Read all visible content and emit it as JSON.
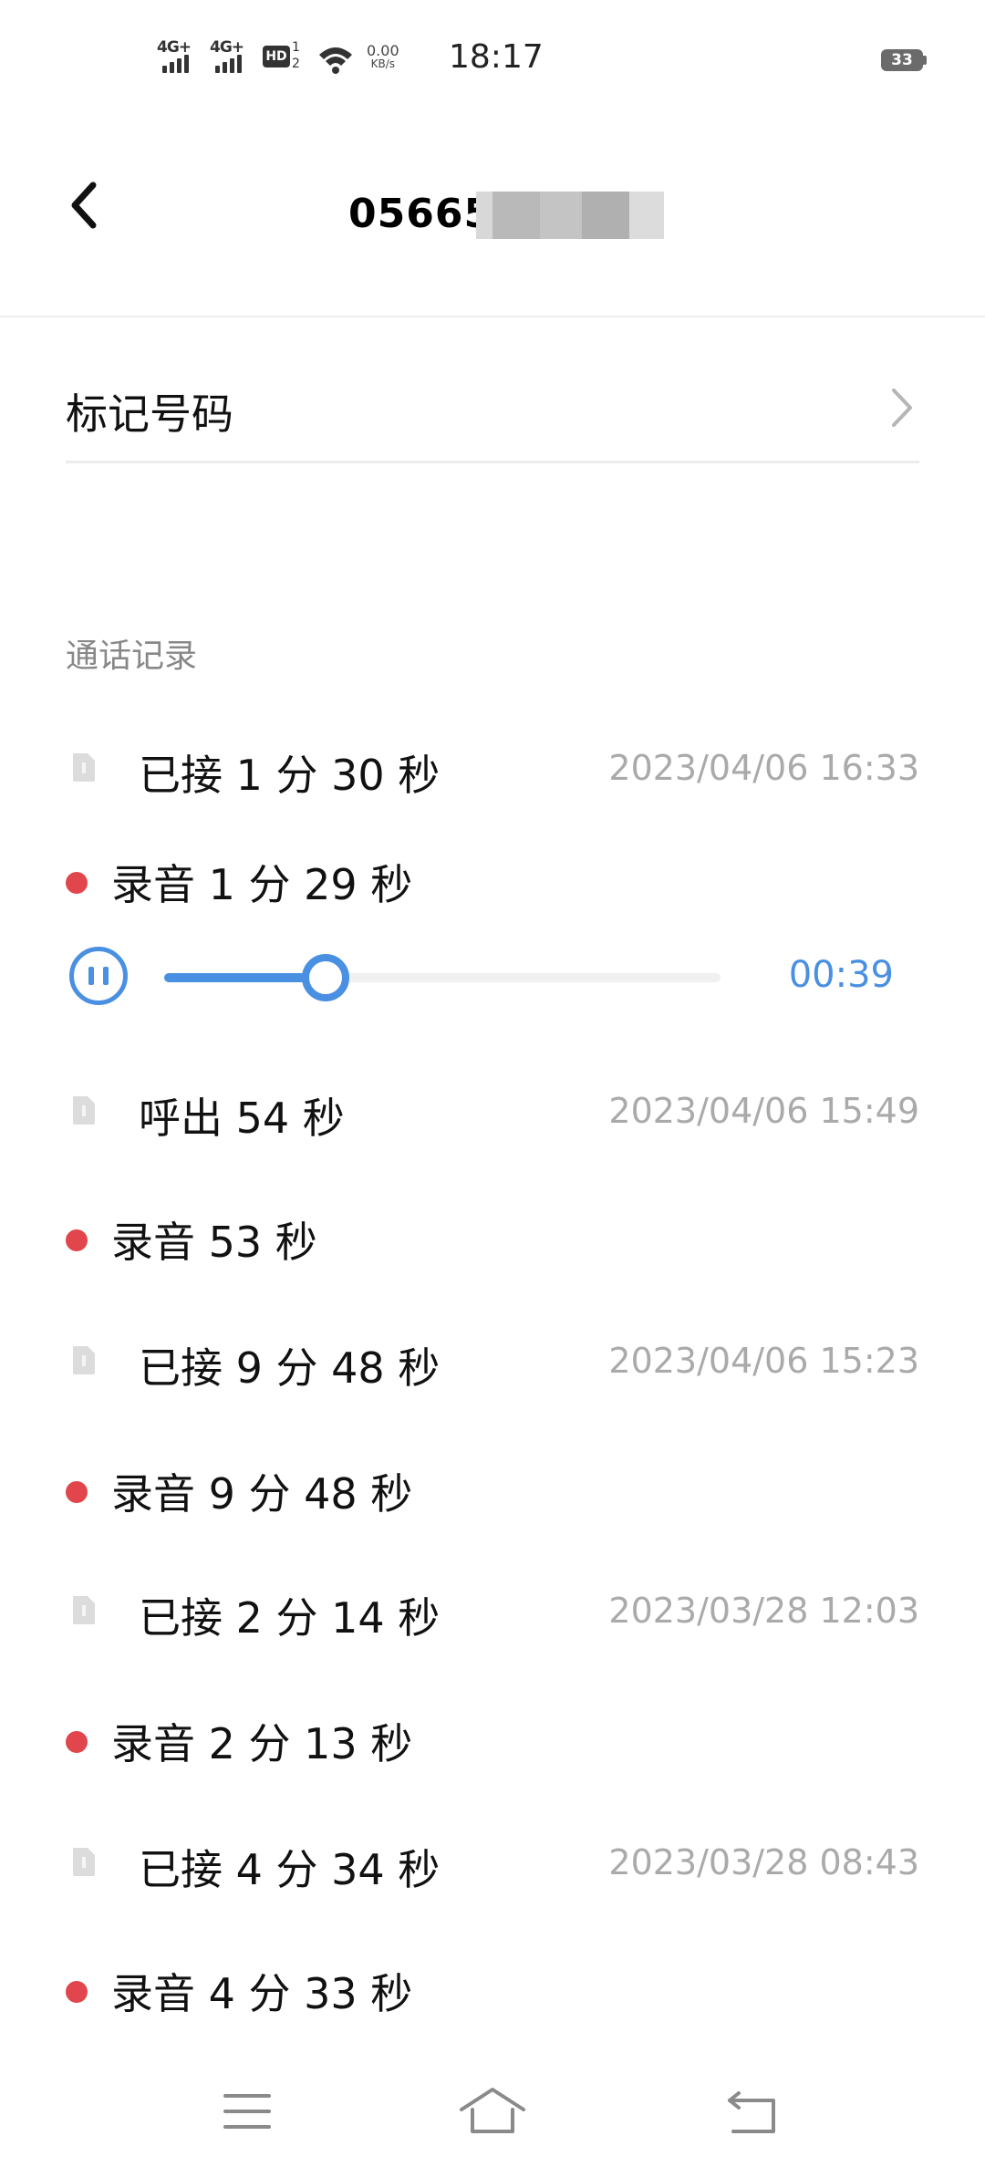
{
  "status_bar": {
    "signal_1": "4G+",
    "signal_2": "4G+",
    "hd_label": "HD",
    "hd_sim_top": "1",
    "hd_sim_bottom": "2",
    "speed_value": "0.00",
    "speed_unit": "KB/s",
    "time": "18:17",
    "battery": "33"
  },
  "header": {
    "title_visible": "05665",
    "title_redacted": true
  },
  "mark_row": {
    "label": "标记号码"
  },
  "call_log": {
    "title": "通话记录",
    "entries": [
      {
        "call": "已接 1 分 30 秒",
        "date": "2023/04/06 16:33",
        "recording": "录音 1 分 29 秒"
      },
      {
        "call": "呼出 54 秒",
        "date": "2023/04/06 15:49",
        "recording": "录音 53 秒"
      },
      {
        "call": "已接 9 分 48 秒",
        "date": "2023/04/06 15:23",
        "recording": "录音 9 分 48 秒"
      },
      {
        "call": "已接 2 分 14 秒",
        "date": "2023/03/28 12:03",
        "recording": "录音 2 分 13 秒"
      },
      {
        "call": "已接 4 分 34 秒",
        "date": "2023/03/28 08:43",
        "recording": "录音 4 分 33 秒"
      }
    ]
  },
  "player": {
    "time": "00:39",
    "progress": 0.29,
    "state": "playing",
    "accent_color": "#4a90e2"
  },
  "colors": {
    "recording_dot": "#e0464b",
    "secondary_text": "#aaaaaa",
    "section_header": "#888888"
  },
  "icons": {
    "back": "back-arrow-icon",
    "mark_chevron": "chevron-right-icon",
    "call_type": "sim-card-icon",
    "pause": "pause-icon",
    "nav_menu": "menu-icon",
    "nav_home": "home-icon",
    "nav_back": "return-icon"
  }
}
